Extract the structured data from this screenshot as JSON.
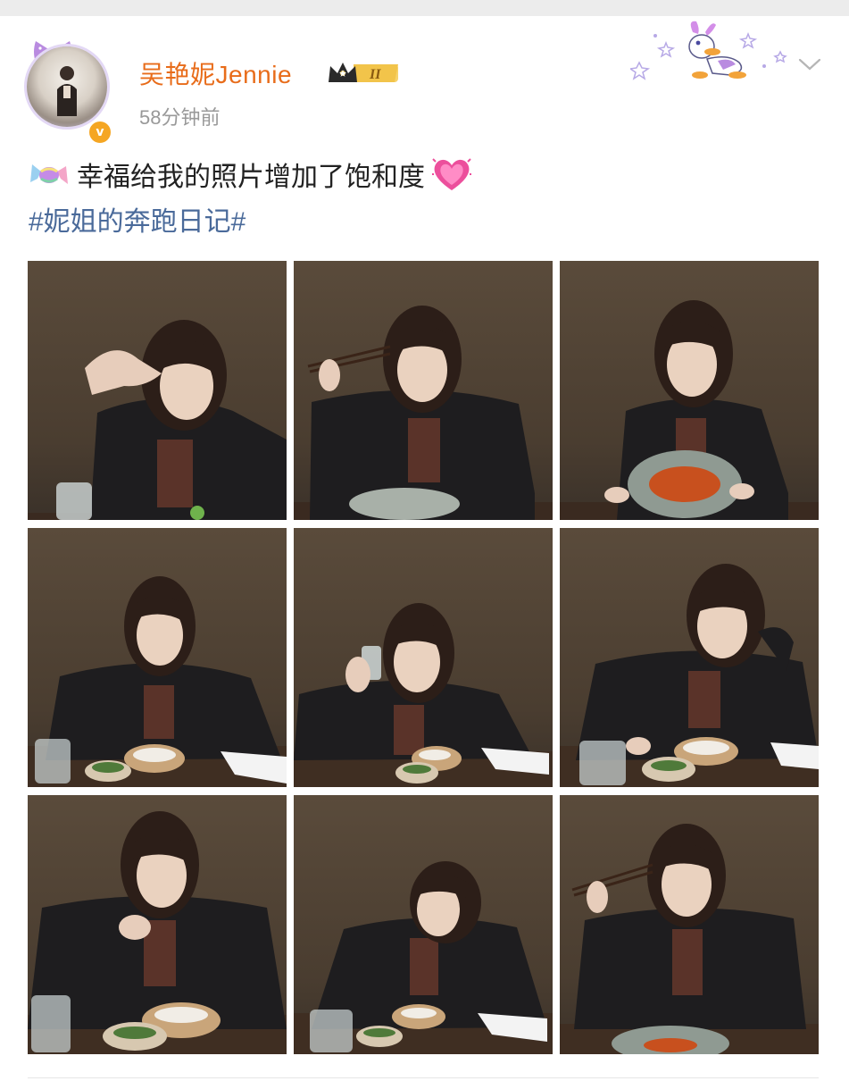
{
  "post": {
    "username": "吴艳妮Jennie",
    "level_badge": "II",
    "timestamp": "58分钟前",
    "text": "幸福给我的照片增加了饱和度",
    "hashtag": "#妮姐的奔跑日记#",
    "verified_mark": "v"
  },
  "icons": {
    "avatar": "avatar-image",
    "verified": "verified-badge-icon",
    "crown": "crown-icon",
    "decoration": "daisy-duck-sticker",
    "more": "chevron-down-icon",
    "candy": "candy-emoji",
    "heart": "heart-emoji"
  },
  "colors": {
    "username": "#e86c1a",
    "hashtag": "#4a6a9a",
    "timestamp": "#999999",
    "verified": "#f5a623"
  },
  "photos": [
    {
      "pose": "hand-raised"
    },
    {
      "pose": "chopsticks-wink"
    },
    {
      "pose": "holding-plate"
    },
    {
      "pose": "seated-bowl"
    },
    {
      "pose": "raising-glass"
    },
    {
      "pose": "leaning-on-hand"
    },
    {
      "pose": "resting-chin"
    },
    {
      "pose": "head-tilt"
    },
    {
      "pose": "chopsticks-up"
    }
  ]
}
